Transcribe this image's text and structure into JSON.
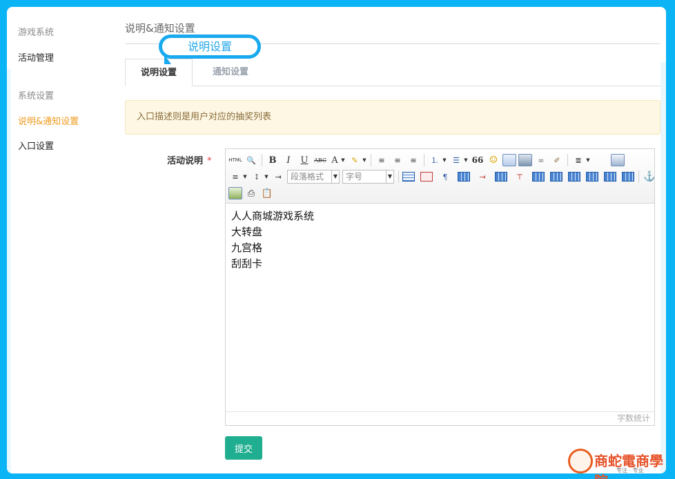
{
  "sidebar": {
    "groups": [
      {
        "title": "游戏系统",
        "items": [
          "活动管理"
        ]
      },
      {
        "title": "系统设置",
        "items": [
          "说明&通知设置",
          "入口设置"
        ]
      }
    ]
  },
  "page": {
    "title": "说明&通知设置",
    "callout": "说明设置"
  },
  "tabs": [
    "说明设置",
    "通知设置"
  ],
  "alert": "入口描述则是用户对应的抽奖列表",
  "form": {
    "label": "活动说明",
    "required_mark": "*"
  },
  "editor": {
    "toolbar": {
      "html_label": "HTML",
      "bold": "B",
      "italic": "I",
      "underline": "U",
      "strike": "ABC",
      "font_color": "A",
      "quote": "66",
      "paragraph_format": "段落格式",
      "font_size": "字号"
    },
    "content": [
      "人人商城游戏系统",
      "大转盘",
      "九宫格",
      "刮刮卡"
    ],
    "word_count_label": "字数统计"
  },
  "submit_label": "提交",
  "logo": {
    "title": "商蛇電商學院",
    "subtitle": "专注 · 专业"
  },
  "colors": {
    "background": "#0ab4f5",
    "active_sidebar": "#f09a1d",
    "submit": "#1fae8f",
    "alert_bg": "#fdf7e3",
    "callout": "#18a9ee"
  }
}
